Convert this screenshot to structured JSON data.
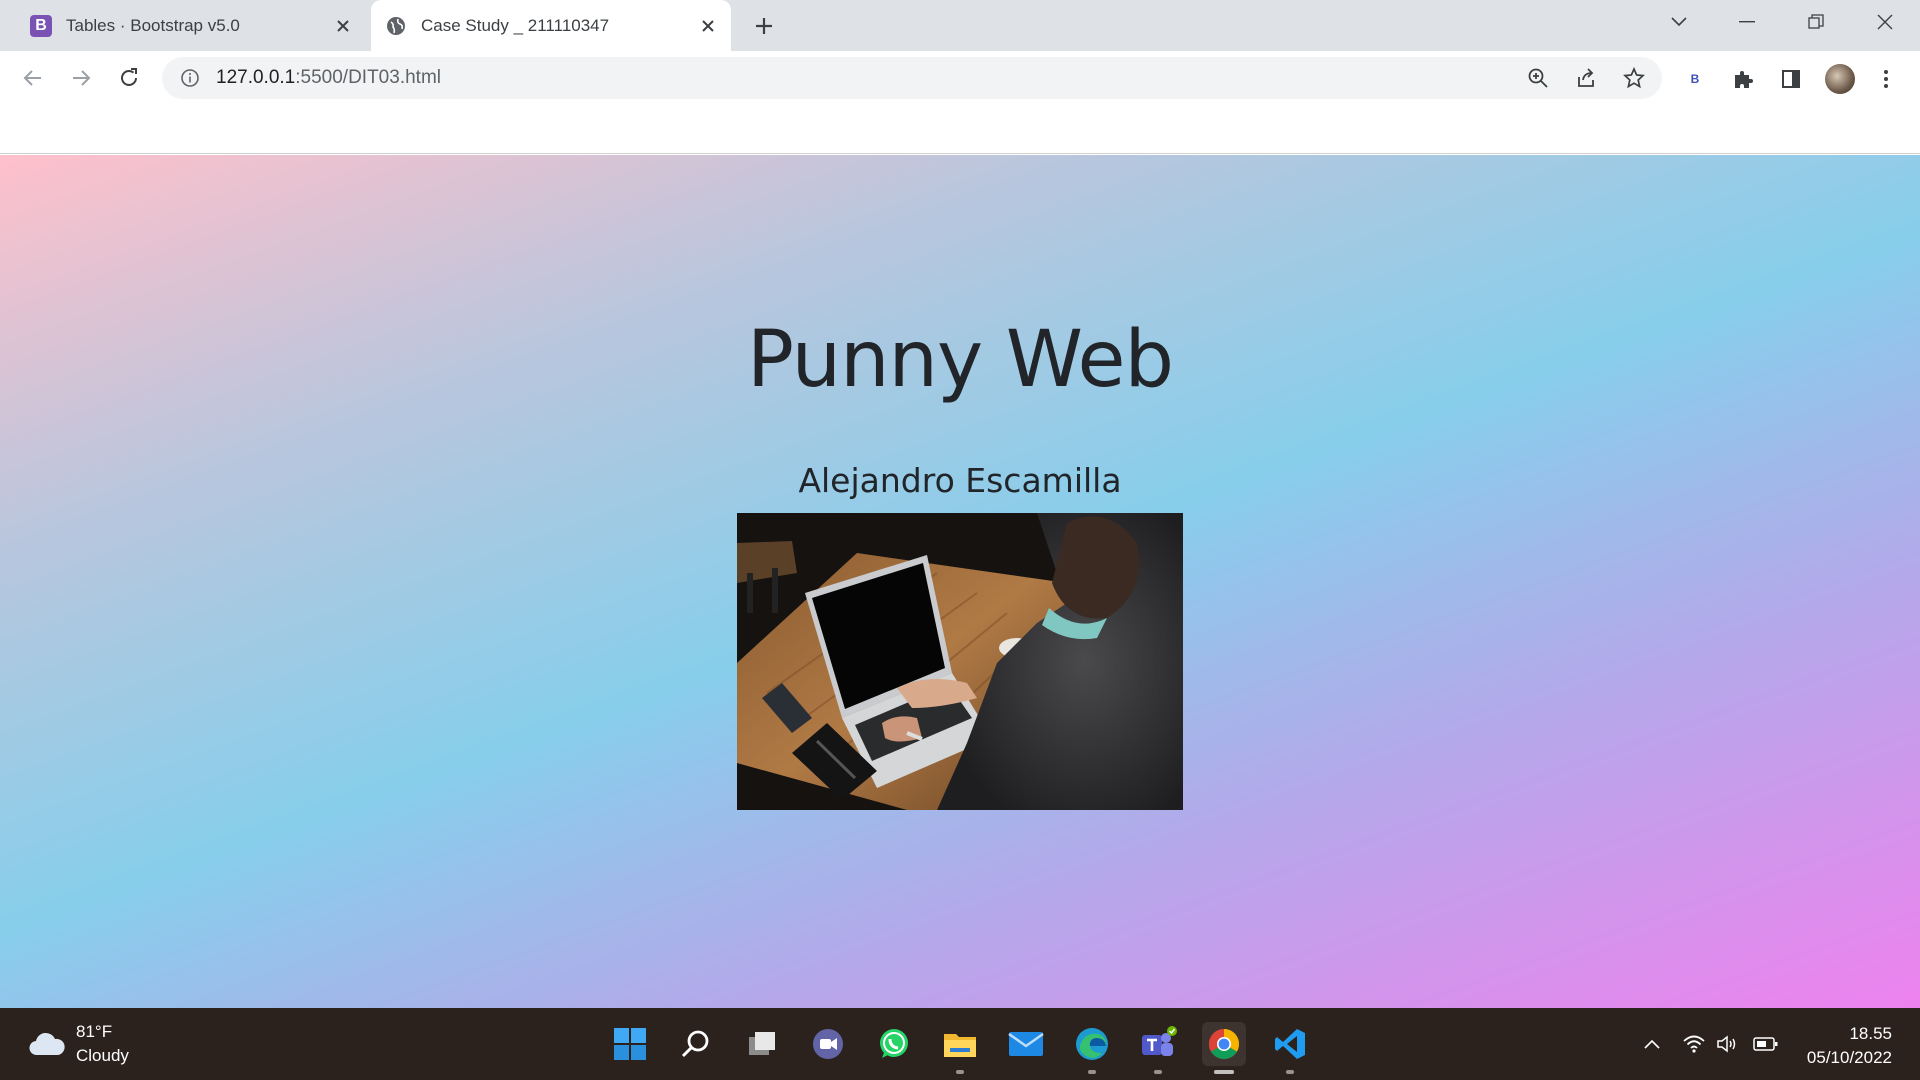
{
  "tabs": [
    {
      "title": "Tables · Bootstrap v5.0",
      "favicon": "B",
      "active": false
    },
    {
      "title": "Case Study _ 211110347",
      "favicon": "globe-icon",
      "active": true
    }
  ],
  "toolbar": {
    "url_host": "127.0.0.1",
    "url_path": ":5500/DIT03.html",
    "extension_label": "B"
  },
  "page": {
    "heading": "Punny Web",
    "subheading": "Alejandro Escamilla",
    "image_alt": "Person typing on a laptop at a wooden table",
    "gradient_colors": [
      "#ffc0cb",
      "#87ceeb",
      "#ee82ee"
    ]
  },
  "taskbar": {
    "weather_temp": "81°F",
    "weather_desc": "Cloudy",
    "time": "18.55",
    "date": "05/10/2022",
    "apps": [
      "windows-start-icon",
      "search-icon",
      "task-view-icon",
      "teams-chat-icon",
      "whatsapp-icon",
      "file-explorer-icon",
      "mail-icon",
      "edge-icon",
      "teams-icon",
      "chrome-icon",
      "vscode-icon"
    ]
  },
  "colors": {
    "accent_bootstrap": "#7952b3",
    "taskbar_bg": "#2b211d",
    "text_dark": "#212529"
  }
}
